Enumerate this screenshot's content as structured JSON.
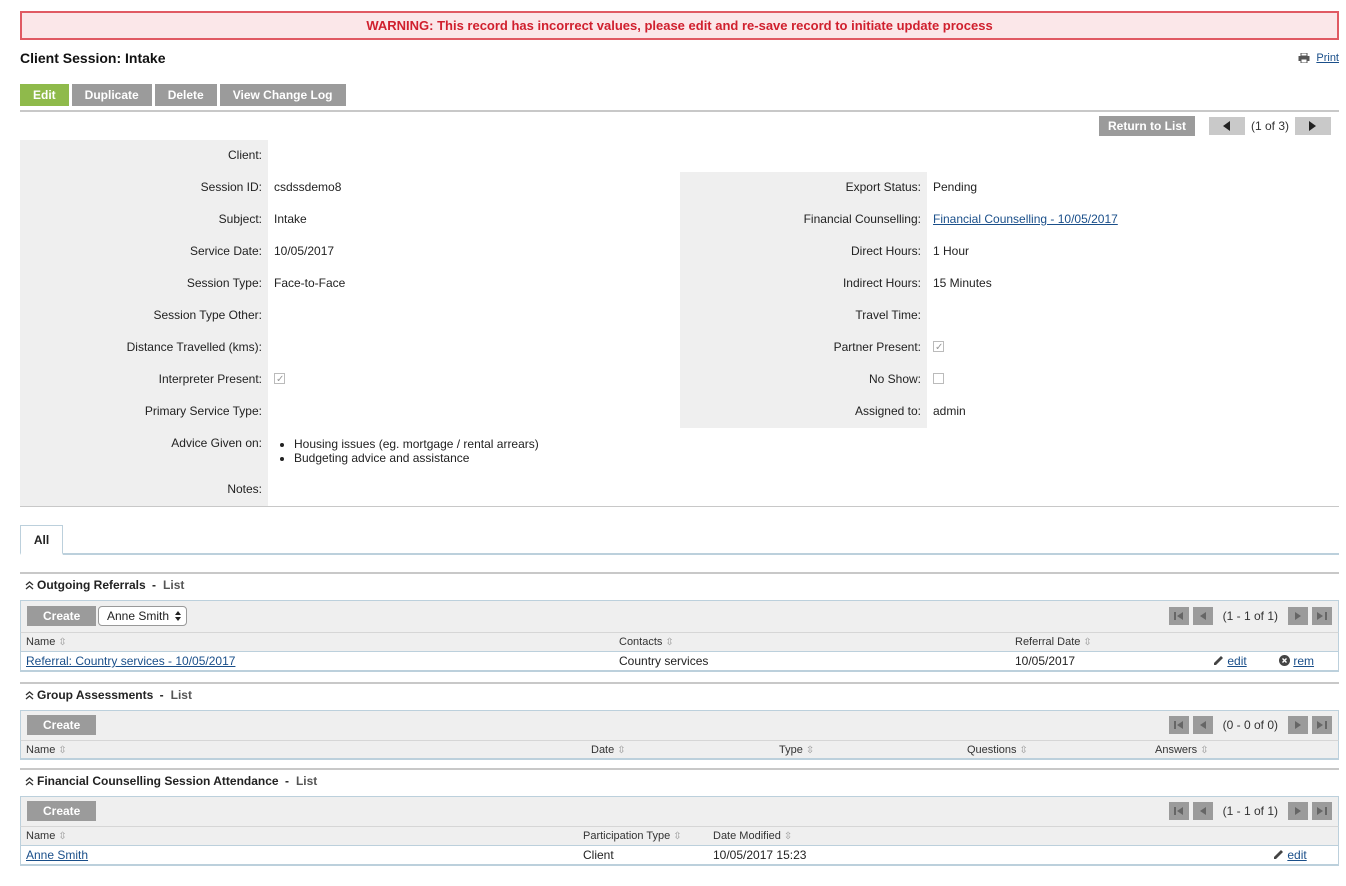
{
  "warning": "WARNING: This record has incorrect values, please edit and re-save record to initiate update process",
  "title": "Client Session: Intake",
  "print_label": "Print",
  "actions": {
    "edit": "Edit",
    "duplicate": "Duplicate",
    "delete": "Delete",
    "changelog": "View Change Log"
  },
  "nav": {
    "return": "Return to List",
    "count": "(1 of 3)"
  },
  "left_fields": {
    "client": {
      "label": "Client:",
      "value": ""
    },
    "session_id": {
      "label": "Session ID:",
      "value": "csdssdemo8"
    },
    "subject": {
      "label": "Subject:",
      "value": "Intake"
    },
    "service_date": {
      "label": "Service Date:",
      "value": "10/05/2017"
    },
    "session_type": {
      "label": "Session Type:",
      "value": "Face-to-Face"
    },
    "session_type_other": {
      "label": "Session Type Other:",
      "value": ""
    },
    "distance": {
      "label": "Distance Travelled (kms):",
      "value": ""
    },
    "interpreter": {
      "label": "Interpreter Present:",
      "checked": true
    },
    "primary_service": {
      "label": "Primary Service Type:",
      "value": ""
    },
    "advice": {
      "label": "Advice Given on:",
      "items": [
        "Housing issues (eg. mortgage / rental arrears)",
        "Budgeting advice and assistance"
      ]
    },
    "notes": {
      "label": "Notes:",
      "value": ""
    }
  },
  "right_fields": {
    "export_status": {
      "label": "Export Status:",
      "value": "Pending"
    },
    "financial_counselling": {
      "label": "Financial Counselling:",
      "value": "Financial Counselling - 10/05/2017"
    },
    "direct_hours": {
      "label": "Direct Hours:",
      "value": "1 Hour"
    },
    "indirect_hours": {
      "label": "Indirect Hours:",
      "value": "15 Minutes"
    },
    "travel_time": {
      "label": "Travel Time:",
      "value": ""
    },
    "partner_present": {
      "label": "Partner Present:",
      "checked": true
    },
    "no_show": {
      "label": "No Show:",
      "checked": false
    },
    "assigned_to": {
      "label": "Assigned to:",
      "value": "admin"
    }
  },
  "tabs": {
    "all": "All"
  },
  "list_label": "List",
  "create_label": "Create",
  "referrals": {
    "title": "Outgoing Referrals",
    "select": "Anne Smith",
    "pager": "(1 - 1 of 1)",
    "columns": {
      "name": "Name",
      "contacts": "Contacts",
      "date": "Referral Date"
    },
    "row": {
      "name": "Referral: Country services - 10/05/2017",
      "contacts": "Country services",
      "date": "10/05/2017",
      "edit": "edit",
      "rem": "rem"
    }
  },
  "group": {
    "title": "Group Assessments",
    "pager": "(0 - 0 of 0)",
    "columns": {
      "name": "Name",
      "date": "Date",
      "type": "Type",
      "questions": "Questions",
      "answers": "Answers"
    }
  },
  "attendance": {
    "title": "Financial Counselling Session Attendance",
    "pager": "(1 - 1 of 1)",
    "columns": {
      "name": "Name",
      "ptype": "Participation Type",
      "modified": "Date Modified"
    },
    "row": {
      "name": "Anne Smith",
      "ptype": "Client",
      "modified": "10/05/2017 15:23",
      "edit": "edit"
    }
  }
}
